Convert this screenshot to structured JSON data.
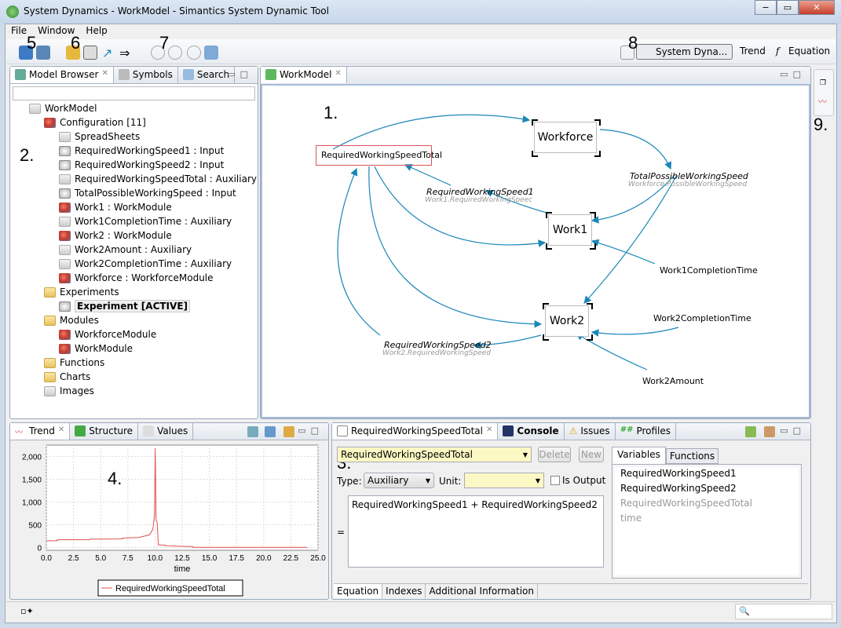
{
  "window": {
    "title": "System Dynamics - WorkModel - Simantics System Dynamic Tool",
    "controls": [
      "−",
      "▭",
      "✕"
    ]
  },
  "menu": [
    "File",
    "Window",
    "Help"
  ],
  "annotations": {
    "n1": "1.",
    "n2": "2.",
    "n3": "3.",
    "n4": "4.",
    "n5": "5",
    "n6": "6",
    "n7": "7",
    "n8": "8",
    "n9": "9."
  },
  "perspectives": [
    {
      "label": "System Dyna...",
      "active": true
    },
    {
      "label": "Trend"
    },
    {
      "label": "Equation"
    }
  ],
  "model_browser": {
    "tabs": [
      "Model Browser",
      "Symbols",
      "Search"
    ],
    "tree": [
      {
        "label": "WorkModel",
        "icon": "model-icon",
        "level": 0
      },
      {
        "label": "Configuration [11]",
        "icon": "configuration-icon",
        "level": 1
      },
      {
        "label": "SpreadSheets",
        "icon": "spreadsheet-icon",
        "level": 2
      },
      {
        "label": "RequiredWorkingSpeed1 : Input",
        "icon": "input-icon",
        "level": 2
      },
      {
        "label": "RequiredWorkingSpeed2 : Input",
        "icon": "input-icon",
        "level": 2
      },
      {
        "label": "RequiredWorkingSpeedTotal : Auxiliary",
        "icon": "auxiliary-icon",
        "level": 2
      },
      {
        "label": "TotalPossibleWorkingSpeed : Input",
        "icon": "input-icon",
        "level": 2
      },
      {
        "label": "Work1 : WorkModule",
        "icon": "module-icon",
        "level": 2
      },
      {
        "label": "Work1CompletionTime : Auxiliary",
        "icon": "auxiliary-icon",
        "level": 2
      },
      {
        "label": "Work2 : WorkModule",
        "icon": "module-icon",
        "level": 2
      },
      {
        "label": "Work2Amount : Auxiliary",
        "icon": "auxiliary-icon",
        "level": 2
      },
      {
        "label": "Work2CompletionTime : Auxiliary",
        "icon": "auxiliary-icon",
        "level": 2
      },
      {
        "label": "Workforce : WorkforceModule",
        "icon": "module-icon",
        "level": 2
      },
      {
        "label": "Experiments",
        "icon": "folder-icon",
        "level": 1
      },
      {
        "label": "Experiment [ACTIVE]",
        "icon": "experiment-icon",
        "level": 2,
        "bold": true
      },
      {
        "label": "Modules",
        "icon": "folder-icon",
        "level": 1
      },
      {
        "label": "WorkforceModule",
        "icon": "module-icon",
        "level": 2
      },
      {
        "label": "WorkModule",
        "icon": "module-icon",
        "level": 2
      },
      {
        "label": "Functions",
        "icon": "folder-icon",
        "level": 1
      },
      {
        "label": "Charts",
        "icon": "folder-icon",
        "level": 1
      },
      {
        "label": "Images",
        "icon": "images-icon",
        "level": 1
      }
    ]
  },
  "editor": {
    "tab": "WorkModel",
    "diagram": {
      "aux_selected": "RequiredWorkingSpeedTotal",
      "modules": [
        "Workforce",
        "Work1",
        "Work2"
      ],
      "inputs": [
        {
          "name": "RequiredWorkingSpeed1",
          "ref": "Work1.RequiredWorkingSpeec"
        },
        {
          "name": "TotalPossibleWorkingSpeed",
          "ref": "Workforce.PossibleWorkingSpeed"
        },
        {
          "name": "RequiredWorkingSpeed2",
          "ref": "Work2.RequiredWorkingSpeed"
        }
      ],
      "auxiliaries": [
        "Work1CompletionTime",
        "Work2CompletionTime",
        "Work2Amount"
      ],
      "arrow_color": "#1a86b8",
      "selected_border": "#d9545c"
    }
  },
  "trend": {
    "tabs": [
      "Trend",
      "Structure",
      "Values"
    ]
  },
  "chart_data": {
    "type": "line",
    "xlabel": "time",
    "ylabel": "",
    "xlim": [
      0,
      25
    ],
    "ylim": [
      -60,
      2250
    ],
    "xticks": [
      "0.0",
      "2.5",
      "5.0",
      "7.5",
      "10.0",
      "12.5",
      "15.0",
      "17.5",
      "20.0",
      "22.5",
      "25.0"
    ],
    "yticks": [
      "0",
      "500",
      "1,000",
      "1,500",
      "2,000"
    ],
    "grid": true,
    "legend_placement": "bottom",
    "series": [
      {
        "name": "RequiredWorkingSpeedTotal",
        "color": "#e05050",
        "x": [
          0,
          1,
          1,
          4,
          4,
          7,
          7,
          8.5,
          9.5,
          9.8,
          9.95,
          10.02,
          10.1,
          10.2,
          10.3,
          11,
          11,
          12,
          13.5,
          13.5,
          24
        ],
        "y": [
          150,
          150,
          170,
          175,
          185,
          190,
          210,
          220,
          280,
          400,
          700,
          2180,
          600,
          560,
          60,
          50,
          40,
          30,
          20,
          5,
          5
        ]
      }
    ]
  },
  "equation": {
    "tabs": [
      "RequiredWorkingSpeedTotal",
      "Console",
      "Issues",
      "Profiles"
    ],
    "variable": "RequiredWorkingSpeedTotal",
    "delete": "Delete",
    "new": "New",
    "type_label": "Type:",
    "type_value": "Auxiliary",
    "unit_label": "Unit:",
    "unit_value": "",
    "is_output": "Is Output",
    "eq_sign": "=",
    "expression": "RequiredWorkingSpeed1 + RequiredWorkingSpeed2",
    "side_tabs": [
      "Variables",
      "Functions"
    ],
    "variables": [
      {
        "name": "RequiredWorkingSpeed1",
        "enabled": true
      },
      {
        "name": "RequiredWorkingSpeed2",
        "enabled": true
      },
      {
        "name": "RequiredWorkingSpeedTotal",
        "enabled": false
      },
      {
        "name": "time",
        "enabled": false
      }
    ],
    "bottom_tabs": [
      "Equation",
      "Indexes",
      "Additional Information"
    ]
  }
}
